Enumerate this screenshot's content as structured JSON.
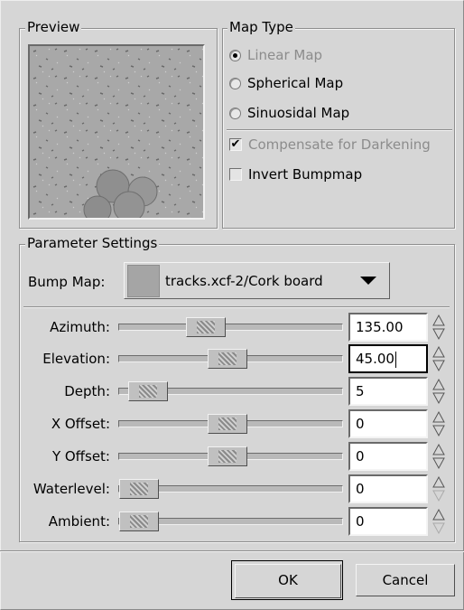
{
  "preview": {
    "title": "Preview"
  },
  "map_type": {
    "title": "Map Type",
    "options": [
      {
        "label": "Linear Map",
        "selected": true,
        "enabled": false
      },
      {
        "label": "Spherical Map",
        "selected": false,
        "enabled": true
      },
      {
        "label": "Sinuosidal Map",
        "selected": false,
        "enabled": true
      }
    ],
    "checks": [
      {
        "label": "Compensate for Darkening",
        "checked": true,
        "enabled": false
      },
      {
        "label": "Invert Bumpmap",
        "checked": false,
        "enabled": true
      }
    ]
  },
  "parameters": {
    "title": "Parameter Settings",
    "bump_map_label": "Bump Map:",
    "bump_map_value": "tracks.xcf-2/Cork board",
    "rows": [
      {
        "label": "Azimuth:",
        "value": "135.00"
      },
      {
        "label": "Elevation:",
        "value": "45.00"
      },
      {
        "label": "Depth:",
        "value": "5"
      },
      {
        "label": "X Offset:",
        "value": "0"
      },
      {
        "label": "Y Offset:",
        "value": "0"
      },
      {
        "label": "Waterlevel:",
        "value": "0"
      },
      {
        "label": "Ambient:",
        "value": "0"
      }
    ]
  },
  "buttons": {
    "ok": "OK",
    "cancel": "Cancel"
  }
}
